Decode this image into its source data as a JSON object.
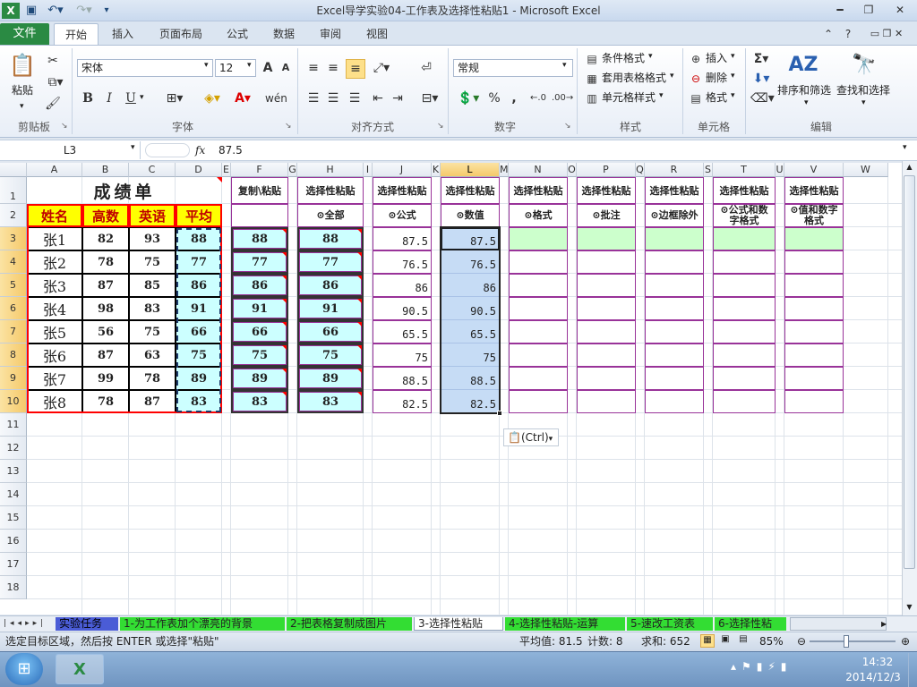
{
  "window": {
    "title": "Excel导学实验04-工作表及选择性粘贴1 - Microsoft Excel"
  },
  "colors": {
    "file_tab": "#2a8a43",
    "header_fill": "#ffff00",
    "header_border": "#ff0000",
    "header_text": "#c00000",
    "copy_fill": "#ccffff",
    "value_fill": "#c6dcf5",
    "green_fill": "#ccffcc",
    "purple_border": "#993399",
    "selected_header": "#f5c96a"
  },
  "ribbon": {
    "tabs": [
      "文件",
      "开始",
      "插入",
      "页面布局",
      "公式",
      "数据",
      "审阅",
      "视图"
    ],
    "groups": [
      "剪贴板",
      "字体",
      "对齐方式",
      "数字",
      "样式",
      "单元格",
      "编辑"
    ],
    "paste": "粘贴",
    "font_name": "宋体",
    "font_size": "12",
    "number_format": "常规",
    "bold": "B",
    "italic": "I",
    "underline": "U",
    "percent": "%",
    "comma": ",",
    "styles": [
      "条件格式",
      "套用表格格式",
      "单元格样式"
    ],
    "cells": [
      "插入",
      "删除",
      "格式"
    ],
    "sort_filter": "排序和筛选",
    "find_select": "查找和选择"
  },
  "formula": {
    "name_box": "L3",
    "fx": "fx",
    "value": "87.5"
  },
  "columns": [
    "A",
    "B",
    "C",
    "D",
    "E",
    "F",
    "G",
    "H",
    "I",
    "J",
    "K",
    "L",
    "M",
    "N",
    "O",
    "P",
    "Q",
    "R",
    "S",
    "T",
    "U",
    "V",
    "W"
  ],
  "rows": [
    "1",
    "2",
    "3",
    "4",
    "5",
    "6",
    "7",
    "8",
    "9",
    "10",
    "11",
    "12",
    "13",
    "14",
    "15",
    "16",
    "17",
    "18"
  ],
  "table": {
    "title": "成绩单",
    "headers": [
      "姓名",
      "高数",
      "英语",
      "平均"
    ],
    "names": [
      "张1",
      "张2",
      "张3",
      "张4",
      "张5",
      "张6",
      "张7",
      "张8"
    ],
    "math": [
      "82",
      "78",
      "87",
      "98",
      "56",
      "87",
      "99",
      "78"
    ],
    "english": [
      "93",
      "75",
      "85",
      "83",
      "75",
      "63",
      "78",
      "87"
    ],
    "avg": [
      "88",
      "77",
      "86",
      "91",
      "66",
      "75",
      "89",
      "83"
    ]
  },
  "paste_headers": {
    "F": "复制\\粘贴",
    "H": "选择性粘贴",
    "J": "选择性粘贴",
    "L": "选择性粘贴",
    "N": "选择性粘贴",
    "P": "选择性粘贴",
    "R": "选择性粘贴",
    "T": "选择性粘贴",
    "V": "选择性粘贴"
  },
  "paste_options": {
    "H": "⊙全部",
    "J": "⊙公式",
    "L": "⊙数值",
    "N": "⊙格式",
    "P": "⊙批注",
    "R": "⊙边框除外",
    "T": "⊙公式和数字格式",
    "V": "⊙值和数字格式"
  },
  "copy_values": [
    "88",
    "77",
    "86",
    "91",
    "66",
    "75",
    "89",
    "83"
  ],
  "exact_values": [
    "87.5",
    "76.5",
    "86",
    "90.5",
    "65.5",
    "75",
    "88.5",
    "82.5"
  ],
  "ctrl_tag": "(Ctrl)",
  "sheets": [
    "实验任务",
    "1-为工作表加个漂亮的背景",
    "2-把表格复制成图片",
    "3-选择性粘贴",
    "4-选择性粘贴-运算",
    "5-速改工资表",
    "6-选择性粘"
  ],
  "active_sheet": "3-选择性粘贴",
  "status": {
    "message": "选定目标区域，然后按 ENTER 或选择\"粘贴\"",
    "average": "平均值: 81.5",
    "count": "计数: 8",
    "sum": "求和: 652",
    "zoom": "85%"
  },
  "taskbar": {
    "time": "14:32",
    "date": "2014/12/3"
  }
}
